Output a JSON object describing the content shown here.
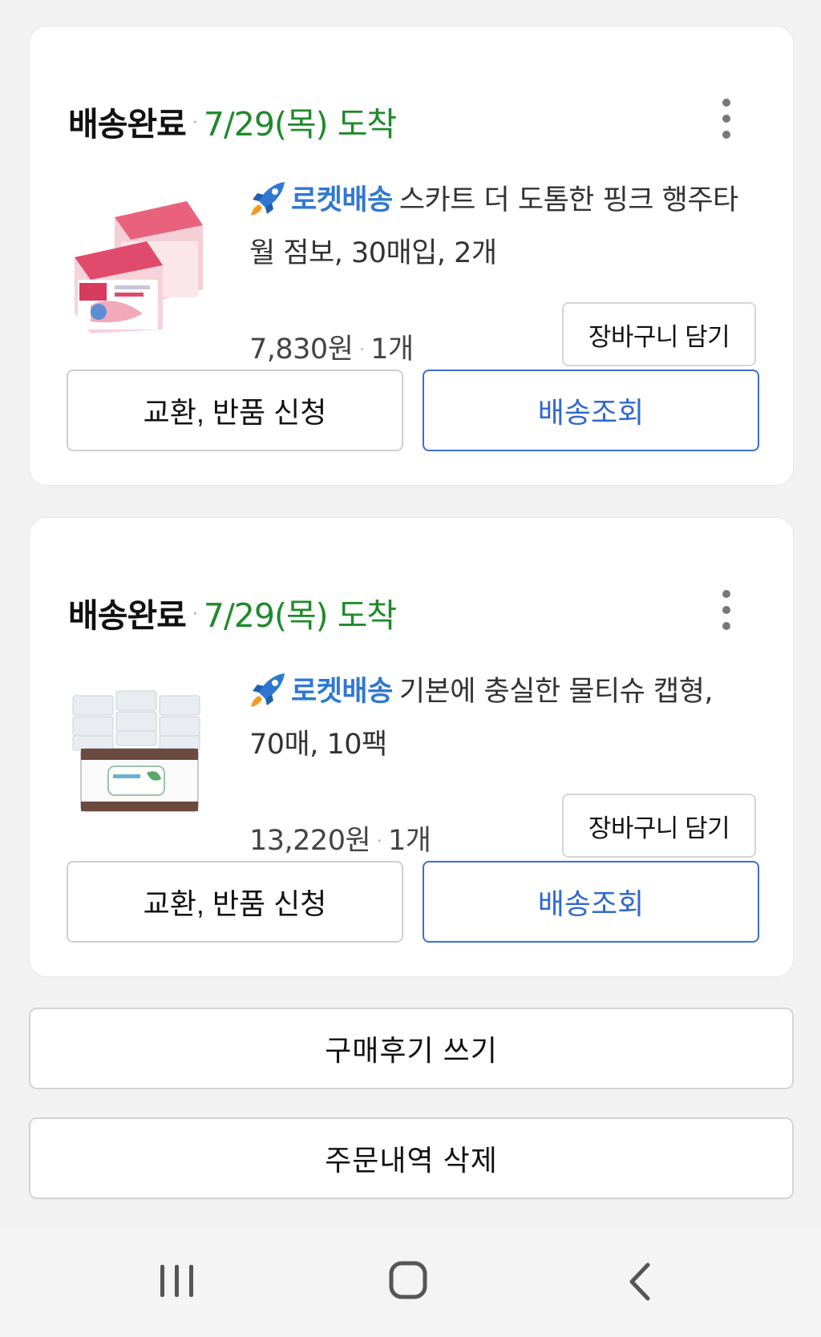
{
  "orders": [
    {
      "status": "배송완료",
      "arrival": "7/29(목) 도착",
      "rocket_label": "로켓배송",
      "product_title": "스카트 더 도톰한 핑크 행주타월 점보, 30매입, 2개",
      "price": "7,830원",
      "quantity": "1개",
      "cart_button": "장바구니 담기",
      "exchange_button": "교환, 반품 신청",
      "track_button": "배송조회"
    },
    {
      "status": "배송완료",
      "arrival": "7/29(목) 도착",
      "rocket_label": "로켓배송",
      "product_title": "기본에 충실한 물티슈 캡형, 70매, 10팩",
      "price": "13,220원",
      "quantity": "1개",
      "cart_button": "장바구니 담기",
      "exchange_button": "교환, 반품 신청",
      "track_button": "배송조회"
    }
  ],
  "actions": {
    "review_button": "구매후기 쓰기",
    "delete_button": "주문내역 삭제"
  },
  "colors": {
    "arrival_green": "#1f8a2b",
    "rocket_blue": "#2f78d1",
    "track_border": "#3b6fd0"
  },
  "icons": {
    "more": "more-vertical-icon",
    "rocket": "rocket-icon",
    "nav_recent": "recent-apps-icon",
    "nav_home": "home-icon",
    "nav_back": "back-icon"
  }
}
